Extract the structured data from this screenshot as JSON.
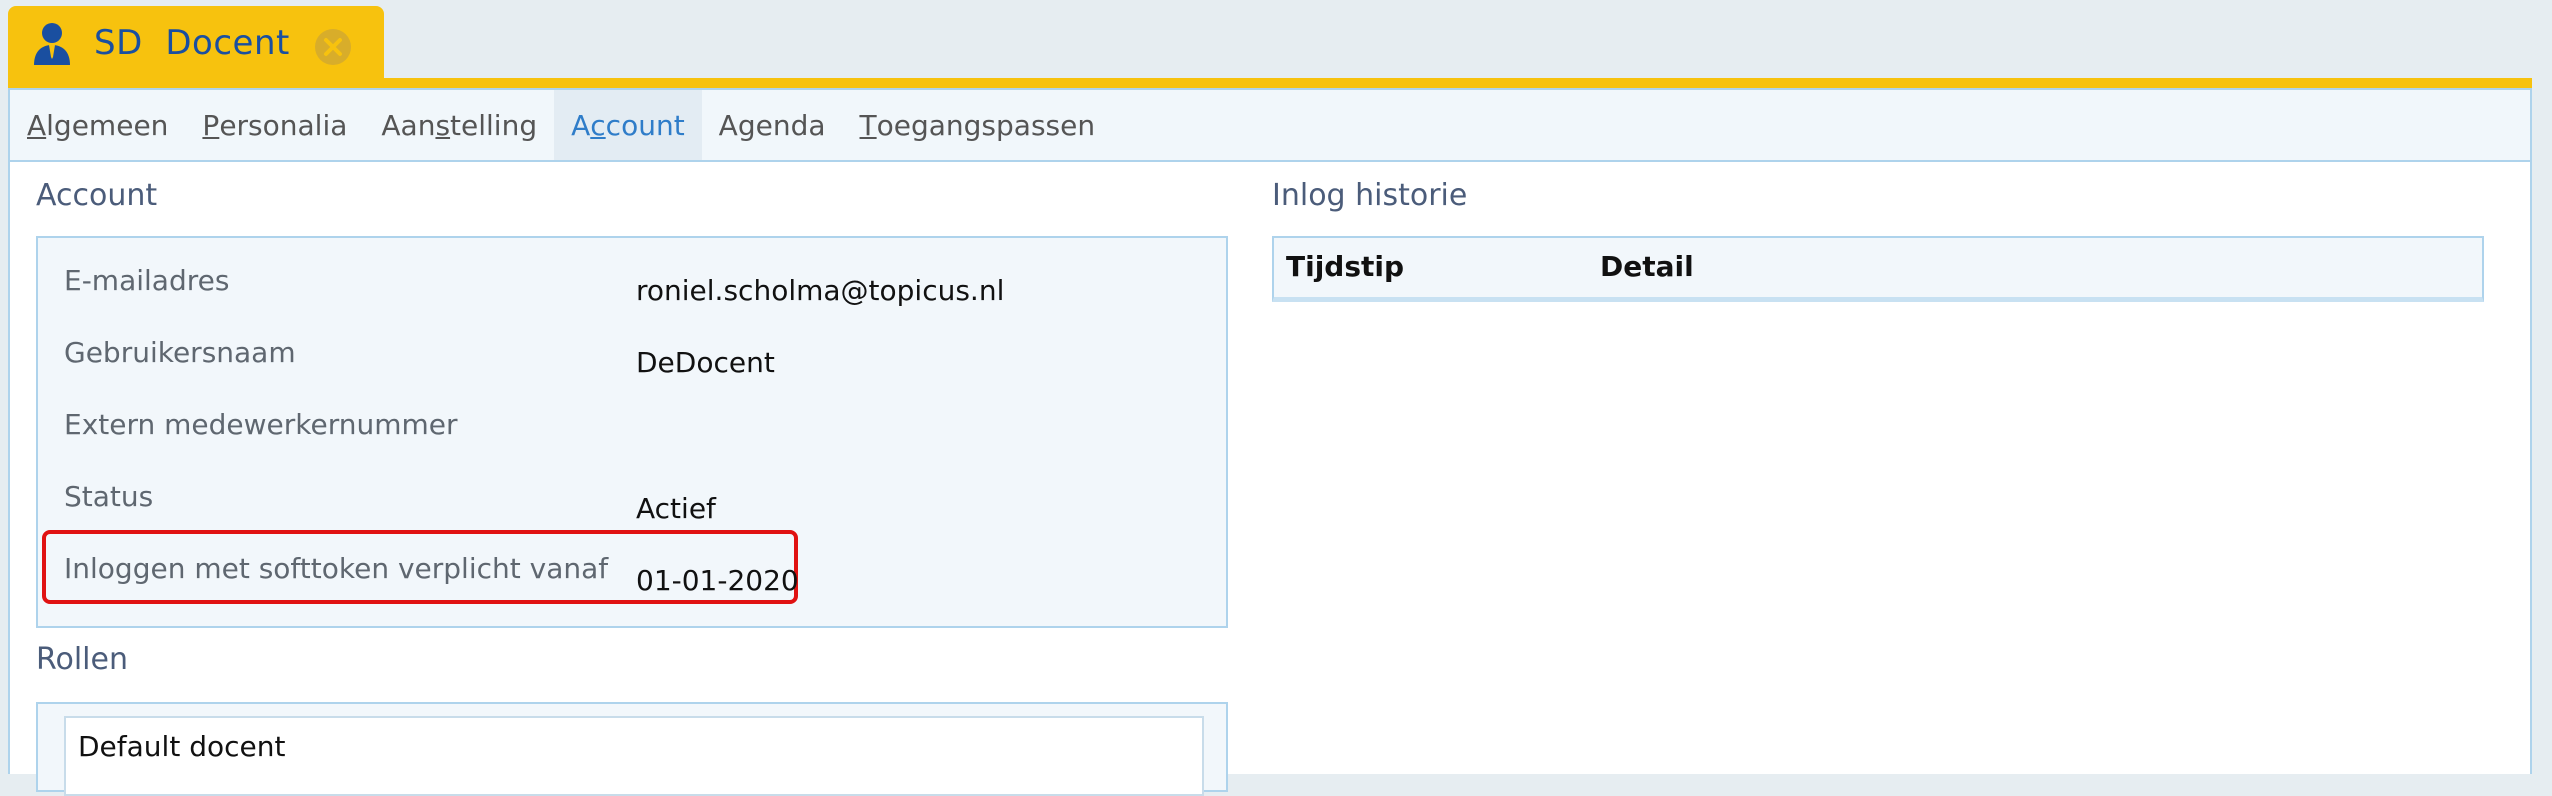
{
  "window_tab": {
    "title": "SD  Docent",
    "icon": "person-icon",
    "close_icon": "close-icon",
    "accent_color": "#f7c20e"
  },
  "subtabs": [
    {
      "first": "A",
      "rest": "lgemeen",
      "prefix": "",
      "active": false
    },
    {
      "first": "P",
      "rest": "ersonalia",
      "prefix": "",
      "active": false
    },
    {
      "prefix": "Aan",
      "first": "s",
      "rest": "telling",
      "active": false
    },
    {
      "prefix": "A",
      "first": "c",
      "rest": "count",
      "active": true
    },
    {
      "prefix": "",
      "first": "A",
      "rest": "genda",
      "active": false,
      "no_underline": true
    },
    {
      "first": "T",
      "rest": "oegangspassen",
      "prefix": "",
      "active": false
    }
  ],
  "account": {
    "title": "Account",
    "fields": [
      {
        "label": "E-mailadres",
        "value": "roniel.scholma@topicus.nl"
      },
      {
        "label": "Gebruikersnaam",
        "value": "DeDocent"
      },
      {
        "label": "Extern medewerkernummer",
        "value": ""
      },
      {
        "label": "Status",
        "value": "Actief"
      },
      {
        "label": "Inloggen met softtoken verplicht vanaf",
        "value": "01-01-2020"
      }
    ]
  },
  "rollen": {
    "title": "Rollen",
    "items": [
      "Default docent"
    ]
  },
  "history": {
    "title": "Inlog historie",
    "columns": [
      "Tijdstip",
      "Detail"
    ]
  }
}
